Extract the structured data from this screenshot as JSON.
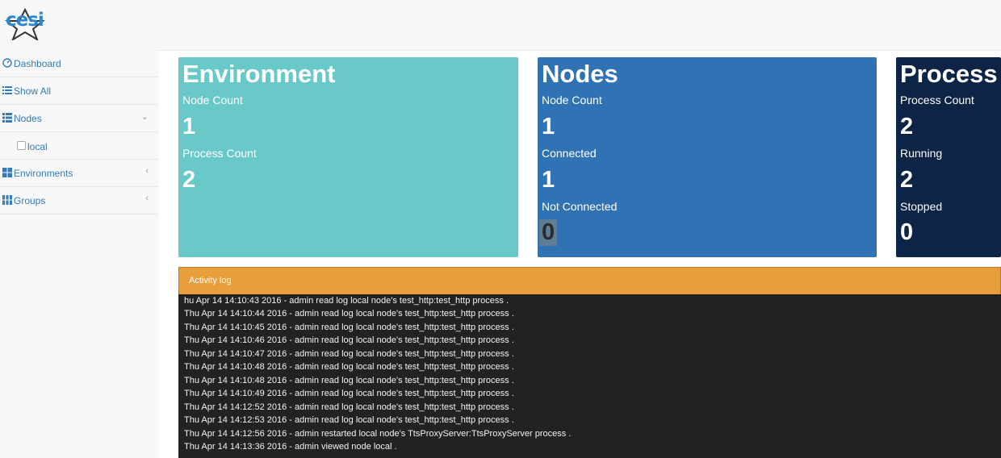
{
  "brand": {
    "logo_text": "cesi"
  },
  "sidebar": {
    "items": [
      {
        "label": "Dashboard",
        "icon": "dashboard-icon"
      },
      {
        "label": "Show All",
        "icon": "list-icon"
      },
      {
        "label": "Nodes",
        "icon": "grid-icon",
        "expanded": true,
        "children": [
          {
            "label": "local",
            "icon": "checkbox-icon"
          }
        ]
      },
      {
        "label": "Environments",
        "icon": "grid-icon",
        "expanded": false
      },
      {
        "label": "Groups",
        "icon": "columns-icon",
        "expanded": false
      }
    ]
  },
  "cards": {
    "environment": {
      "title": "Environment",
      "stats": [
        {
          "label": "Node Count",
          "value": "1"
        },
        {
          "label": "Process Count",
          "value": "2"
        }
      ]
    },
    "nodes": {
      "title": "Nodes",
      "stats": [
        {
          "label": "Node Count",
          "value": "1"
        },
        {
          "label": "Connected",
          "value": "1"
        },
        {
          "label": "Not Connected",
          "value": "0"
        }
      ]
    },
    "process": {
      "title": "Process",
      "stats": [
        {
          "label": "Process Count",
          "value": "2"
        },
        {
          "label": "Running",
          "value": "2"
        },
        {
          "label": "Stopped",
          "value": "0"
        }
      ]
    }
  },
  "activity_log": {
    "title": "Activity log",
    "lines": [
      "hu Apr 14 14:10:43 2016 - admin read log local node's test_http:test_http process .",
      "Thu Apr 14 14:10:44 2016 - admin read log local node's test_http:test_http process .",
      "Thu Apr 14 14:10:45 2016 - admin read log local node's test_http:test_http process .",
      "Thu Apr 14 14:10:46 2016 - admin read log local node's test_http:test_http process .",
      "Thu Apr 14 14:10:47 2016 - admin read log local node's test_http:test_http process .",
      "Thu Apr 14 14:10:48 2016 - admin read log local node's test_http:test_http process .",
      "Thu Apr 14 14:10:48 2016 - admin read log local node's test_http:test_http process .",
      "Thu Apr 14 14:10:49 2016 - admin read log local node's test_http:test_http process .",
      "Thu Apr 14 14:12:52 2016 - admin read log local node's test_http:test_http process .",
      "Thu Apr 14 14:12:53 2016 - admin read log local node's test_http:test_http process .",
      "Thu Apr 14 14:12:56 2016 - admin restarted local node's TtsProxyServer:TtsProxyServer process .",
      "Thu Apr 14 14:13:36 2016 - admin viewed node local ."
    ]
  },
  "colors": {
    "environment_card": "#69c9c9",
    "nodes_card": "#2f73b4",
    "process_card": "#0c2446",
    "activity_header": "#e89e3b",
    "activity_body": "#222222",
    "link": "#337ab7"
  }
}
